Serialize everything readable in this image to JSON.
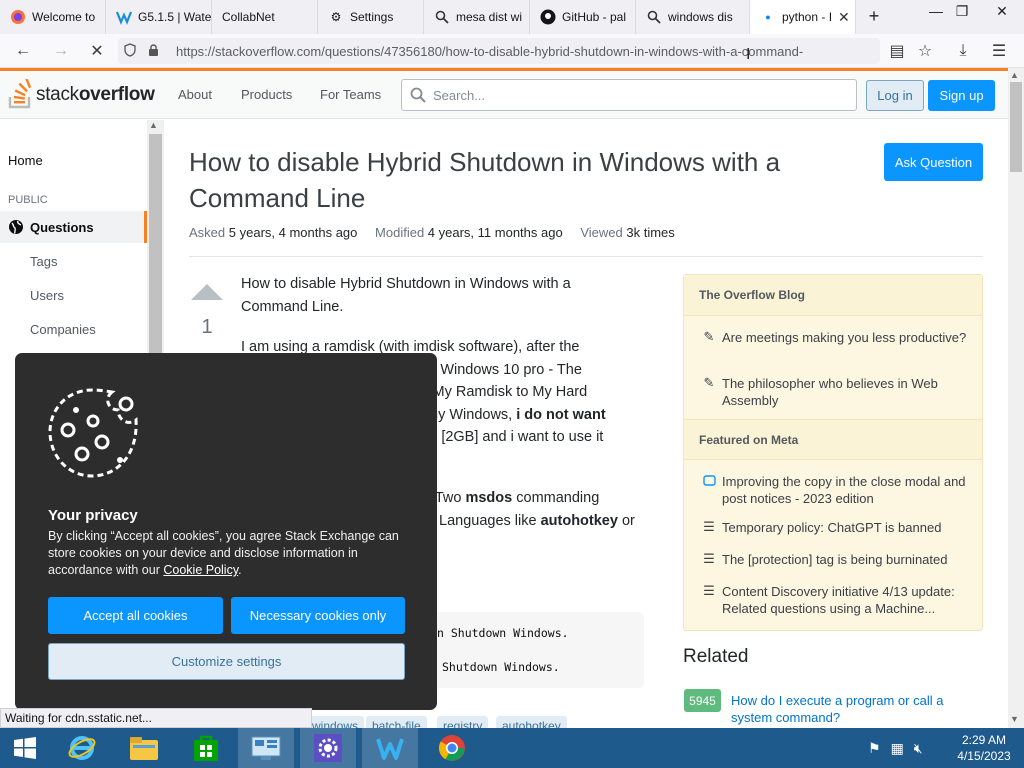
{
  "browser": {
    "tabs": [
      {
        "label": "Welcome to",
        "icon": "firefox-icon"
      },
      {
        "label": "G5.1.5 | Wate",
        "icon": "waterfox-icon"
      },
      {
        "label": "CollabNet",
        "icon": ""
      },
      {
        "label": "Settings",
        "icon": "gear-icon"
      },
      {
        "label": "mesa dist wi",
        "icon": "search-icon"
      },
      {
        "label": "GitHub - pal",
        "icon": "github-icon"
      },
      {
        "label": "windows dis",
        "icon": "search-icon"
      },
      {
        "label": "python - I",
        "icon": "loading-dot-icon"
      }
    ],
    "new_tab": "+",
    "url": "https://stackoverflow.com/questions/47356180/how-to-disable-hybrid-shutdown-in-windows-with-a-command-"
  },
  "so_header": {
    "logo_plain": "stack",
    "logo_bold": "overflow",
    "nav": [
      "About",
      "Products",
      "For Teams"
    ],
    "search_placeholder": "Search...",
    "login": "Log in",
    "signup": "Sign up"
  },
  "left_nav": {
    "home": "Home",
    "public": "PUBLIC",
    "questions": "Questions",
    "tags": "Tags",
    "users": "Users",
    "companies": "Companies"
  },
  "question": {
    "title": "How to disable Hybrid Shutdown in Windows with a Command Line",
    "ask_button": "Ask Question",
    "asked_label": "Asked",
    "asked_value": "5 years, 4 months ago",
    "modified_label": "Modified",
    "modified_value": "4 years, 11 months ago",
    "viewed_label": "Viewed",
    "viewed_value": "3k times",
    "votes": "1",
    "p1": "How to disable Hybrid Shutdown in Windows with a Command Line.",
    "p2_a": "I am using a ramdisk (with imdisk software), after the",
    "p2_b": "ro into Windows 10 pro - The",
    "p2_c": "ic My Ramdisk to My Hard",
    "p2_d": "my Windows,",
    "p2_d_bold": "i do not want",
    "p2_e": "ig [2GB] and i want to use it",
    "p3_a": "e Two",
    "p3_bold1": "msdos",
    "p3_b": "commanding",
    "p3_c": "Languages like",
    "p3_bold2": "autohotkey",
    "p3_d": "or",
    "code_1": "n Shutdown Windows.",
    "code_2": "Shutdown Windows.",
    "tags": [
      "windows",
      "batch-file",
      "registry",
      "autohotkey"
    ]
  },
  "sidebar": {
    "blog_title": "The Overflow Blog",
    "blog_items": [
      "Are meetings making you less productive?",
      "The philosopher who believes in Web Assembly"
    ],
    "meta_title": "Featured on Meta",
    "meta_items": [
      "Improving the copy in the close modal and post notices - 2023 edition",
      "Temporary policy: ChatGPT is banned",
      "The [protection] tag is being burninated",
      "Content Discovery initiative 4/13 update: Related questions using a Machine..."
    ],
    "related_title": "Related",
    "related_count": "5945",
    "related_link": "How do I execute a program or call a system command?"
  },
  "cookie": {
    "title": "Your privacy",
    "text": "By clicking “Accept all cookies”, you agree Stack Exchange can store cookies on your device and disclose information in accordance with our",
    "policy_link": "Cookie Policy",
    "period": ".",
    "accept_all": "Accept all cookies",
    "necessary_only": "Necessary cookies only",
    "customize": "Customize settings"
  },
  "status_text": "Waiting for cdn.sstatic.net...",
  "taskbar": {
    "apps": [
      "ie-icon",
      "file-explorer-icon",
      "store-icon",
      "control-panel-icon",
      "settings-gear-icon",
      "waterfox-icon",
      "chrome-icon"
    ],
    "time": "2:29 AM",
    "date": "4/15/2023"
  },
  "colors": {
    "so_orange": "#f48225",
    "so_blue": "#0a95ff",
    "cookie_bg": "#2d2d2d",
    "taskbar": "#1e5a8c",
    "answered_green": "#5eba7d"
  }
}
